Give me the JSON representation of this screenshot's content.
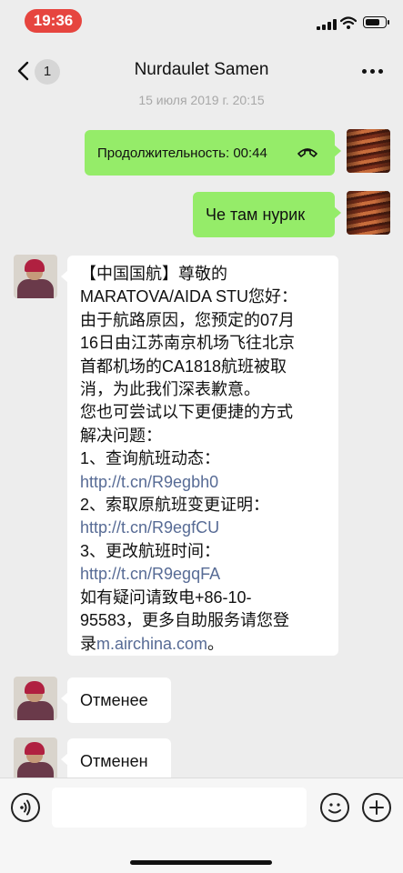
{
  "status_bar": {
    "time": "19:36",
    "battery_level": 0.8
  },
  "header": {
    "back_count": "1",
    "title": "Nurdaulet Samen"
  },
  "date_label": "15 июля 2019 г. 20:15",
  "messages": {
    "call": {
      "label": "Продолжительность: 00:44"
    },
    "mine_text": "Че там нурик",
    "airchina": {
      "lines": [
        "【中国国航】尊敬的",
        "MARATOVA/AIDA STU您好：",
        "由于航路原因，您预定的07月",
        "16日由江苏南京机场飞往北京",
        "首都机场的CA1818航班被取",
        "消，为此我们深表歉意。",
        "您也可尝试以下更便捷的方式",
        "解决问题：",
        "1、查询航班动态：",
        "http://t.cn/R9egbh0",
        "2、索取原航班变更证明：",
        "http://t.cn/R9egfCU",
        "3、更改航班时间：",
        "http://t.cn/R9egqFA",
        "如有疑问请致电+86-10-",
        "95583，更多自助服务请您登",
        "录"
      ],
      "domain_link": "m.airchina.com",
      "end_punct": "。"
    },
    "other_1": "Отменее",
    "other_2": "Отменен"
  },
  "colors": {
    "bubble_mine": "#95ec69",
    "bubble_other": "#ffffff",
    "link": "#576b95",
    "time_pill": "#e6453f"
  },
  "icons": [
    "back-chevron-icon",
    "more-icon",
    "phone-hangup-icon",
    "voice-icon",
    "emoji-icon",
    "plus-icon",
    "signal-icon",
    "wifi-icon",
    "battery-icon"
  ]
}
